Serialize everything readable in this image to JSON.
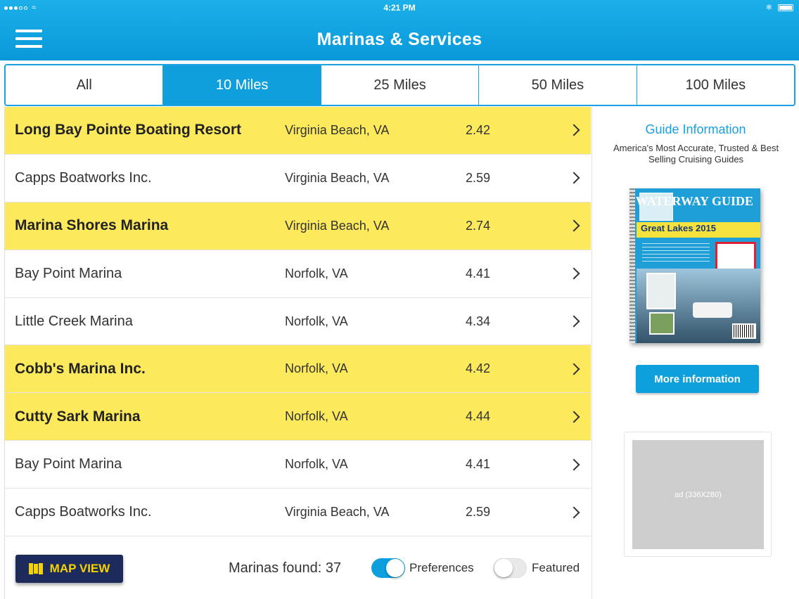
{
  "status_bar": {
    "time": "4:21 PM"
  },
  "header": {
    "title": "Marinas & Services"
  },
  "tabs": [
    {
      "label": "All",
      "active": false
    },
    {
      "label": "10 Miles",
      "active": true
    },
    {
      "label": "25 Miles",
      "active": false
    },
    {
      "label": "50 Miles",
      "active": false
    },
    {
      "label": "100 Miles",
      "active": false
    }
  ],
  "marinas": [
    {
      "name": "Long Bay Pointe Boating Resort",
      "location": "Virginia Beach, VA",
      "distance": "2.42",
      "featured": true
    },
    {
      "name": "Capps Boatworks Inc.",
      "location": "Virginia Beach, VA",
      "distance": "2.59",
      "featured": false
    },
    {
      "name": "Marina Shores Marina",
      "location": "Virginia Beach, VA",
      "distance": "2.74",
      "featured": true
    },
    {
      "name": "Bay Point Marina",
      "location": "Norfolk, VA",
      "distance": "4.41",
      "featured": false
    },
    {
      "name": "Little Creek Marina",
      "location": "Norfolk, VA",
      "distance": "4.34",
      "featured": false
    },
    {
      "name": "Cobb's Marina Inc.",
      "location": "Norfolk, VA",
      "distance": "4.42",
      "featured": true
    },
    {
      "name": "Cutty Sark Marina",
      "location": "Norfolk, VA",
      "distance": "4.44",
      "featured": true
    },
    {
      "name": "Bay Point Marina",
      "location": "Norfolk, VA",
      "distance": "4.41",
      "featured": false
    },
    {
      "name": "Capps Boatworks Inc.",
      "location": "Virginia Beach, VA",
      "distance": "2.59",
      "featured": false
    }
  ],
  "bottom_bar": {
    "map_view_label": "MAP VIEW",
    "marinas_found": "Marinas found: 37",
    "preferences_label": "Preferences",
    "preferences_on": true,
    "featured_label": "Featured",
    "featured_on": false
  },
  "sidebar": {
    "guide_title": "Guide Information",
    "guide_subtitle": "America's Most Accurate, Trusted & Best Selling Cruising Guides",
    "book_brand": "WATERWAY GUIDE",
    "book_title": "Great Lakes 2015",
    "more_info_label": "More information",
    "ad_label": "ad (336X280)"
  },
  "colors": {
    "header_blue": "#0e9fdd",
    "featured_yellow": "#fde95c",
    "map_button_navy": "#1d2b5c",
    "map_button_text": "#f5d300"
  }
}
